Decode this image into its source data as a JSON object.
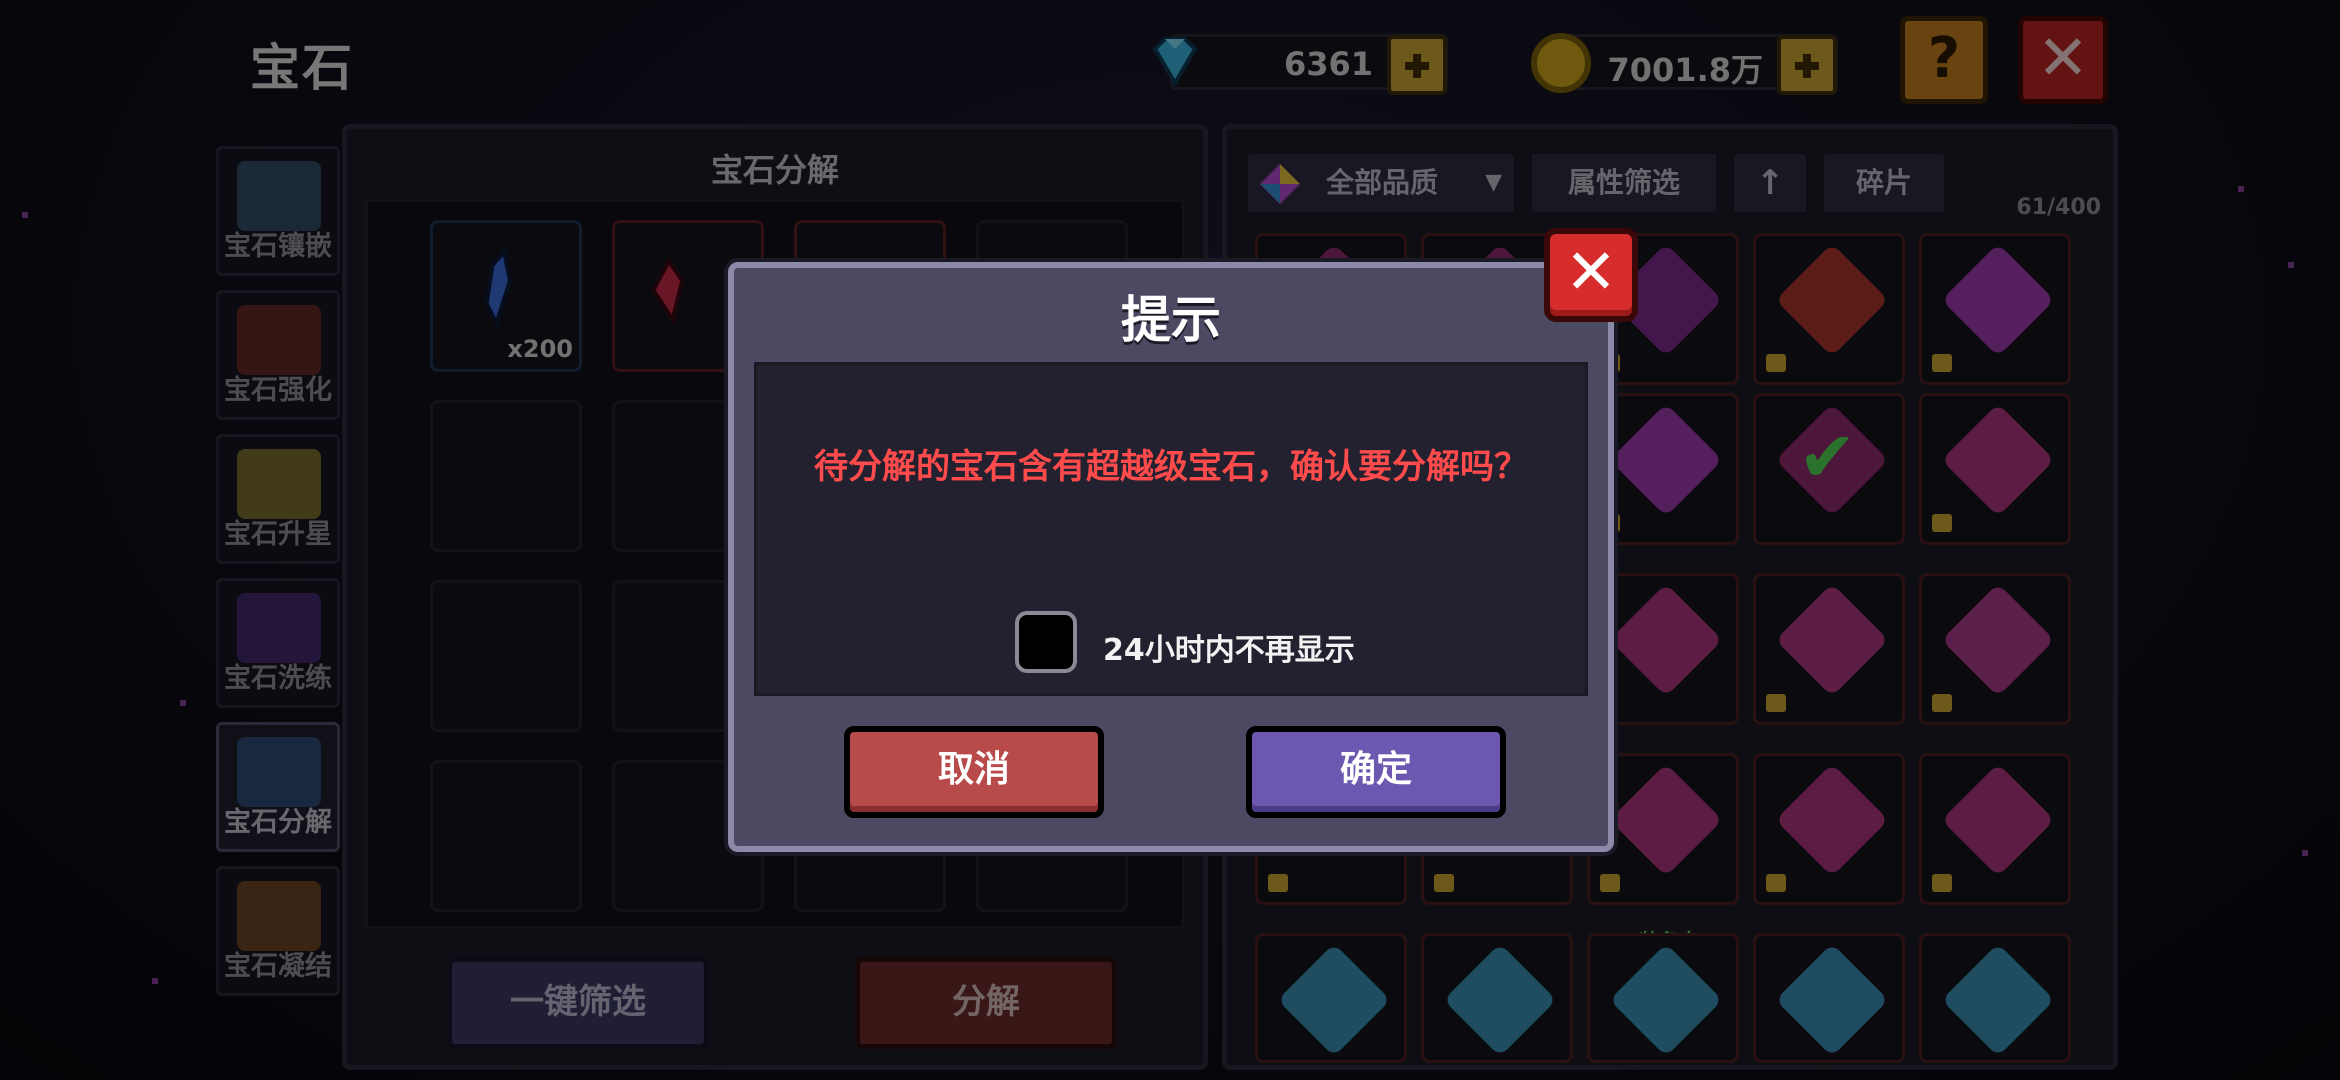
{
  "header": {
    "title": "宝石",
    "gems": "6361",
    "coins": "7001.8万"
  },
  "side_tabs": [
    {
      "label": "宝石镶嵌",
      "color": "#4a7a9a"
    },
    {
      "label": "宝石强化",
      "color": "#a13a2a"
    },
    {
      "label": "宝石升星",
      "color": "#c9b23a"
    },
    {
      "label": "宝石洗练",
      "color": "#6a3aa8"
    },
    {
      "label": "宝石分解",
      "color": "#3a6ab0"
    },
    {
      "label": "宝石凝结",
      "color": "#b06a2a"
    }
  ],
  "left_panel": {
    "title": "宝石分解",
    "first_slot_count": "x200",
    "filter_button": "一键筛选",
    "decompose_button": "分解"
  },
  "right_panel": {
    "quality_dropdown": "全部品质",
    "attr_filter": "属性筛选",
    "sort_icon": "up-arrow-icon",
    "fragments": "碎片",
    "count": "61/400",
    "equipped_label": "装备中"
  },
  "dialog": {
    "title": "提示",
    "message": "待分解的宝石含有超越级宝石，确认要分解吗？",
    "checkbox_label": "24小时内不再显示",
    "cancel": "取消",
    "confirm": "确定",
    "close_icon": "close-icon"
  },
  "colors": {
    "warning": "#ff4b4b",
    "cancel": "#b84a4a",
    "confirm": "#6c58b0",
    "close": "#d62c2c",
    "gold": "#c9a233"
  }
}
